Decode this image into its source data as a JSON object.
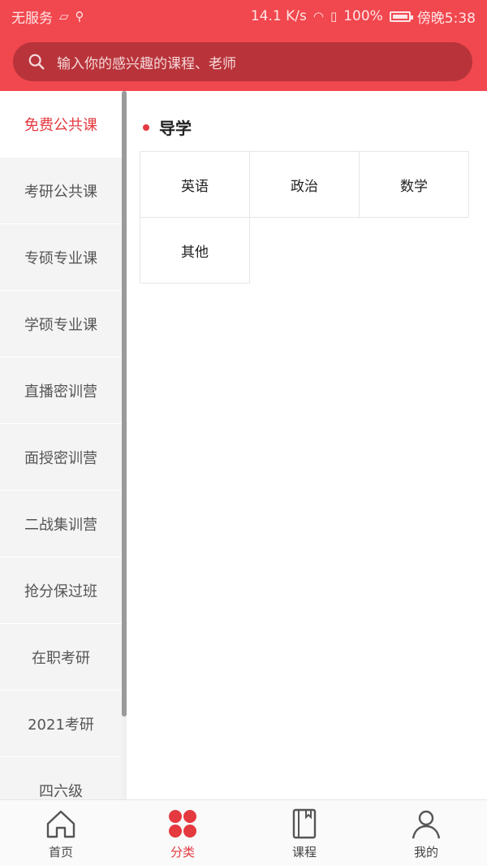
{
  "status_bar": {
    "carrier": "无服务",
    "speed": "14.1 K/s",
    "battery_text": "100%",
    "time": "傍晚5:38"
  },
  "search": {
    "placeholder": "输入你的感兴趣的课程、老师"
  },
  "sidebar": {
    "items": [
      {
        "label": "免费公共课",
        "active": true
      },
      {
        "label": "考研公共课",
        "active": false
      },
      {
        "label": "专硕专业课",
        "active": false
      },
      {
        "label": "学硕专业课",
        "active": false
      },
      {
        "label": "直播密训营",
        "active": false
      },
      {
        "label": "面授密训营",
        "active": false
      },
      {
        "label": "二战集训营",
        "active": false
      },
      {
        "label": "抢分保过班",
        "active": false
      },
      {
        "label": "在职考研",
        "active": false
      },
      {
        "label": "2021考研",
        "active": false
      },
      {
        "label": "四六级",
        "active": false
      }
    ]
  },
  "main": {
    "section_title": "导学",
    "subjects": [
      "英语",
      "政治",
      "数学",
      "其他"
    ]
  },
  "bottom_nav": {
    "items": [
      {
        "label": "首页",
        "icon": "home-icon",
        "active": false
      },
      {
        "label": "分类",
        "icon": "category-icon",
        "active": true
      },
      {
        "label": "课程",
        "icon": "course-icon",
        "active": false
      },
      {
        "label": "我的",
        "icon": "profile-icon",
        "active": false
      }
    ]
  },
  "colors": {
    "brand_red": "#f1474e",
    "accent_red": "#e4393f",
    "search_bg": "#b8343a"
  }
}
